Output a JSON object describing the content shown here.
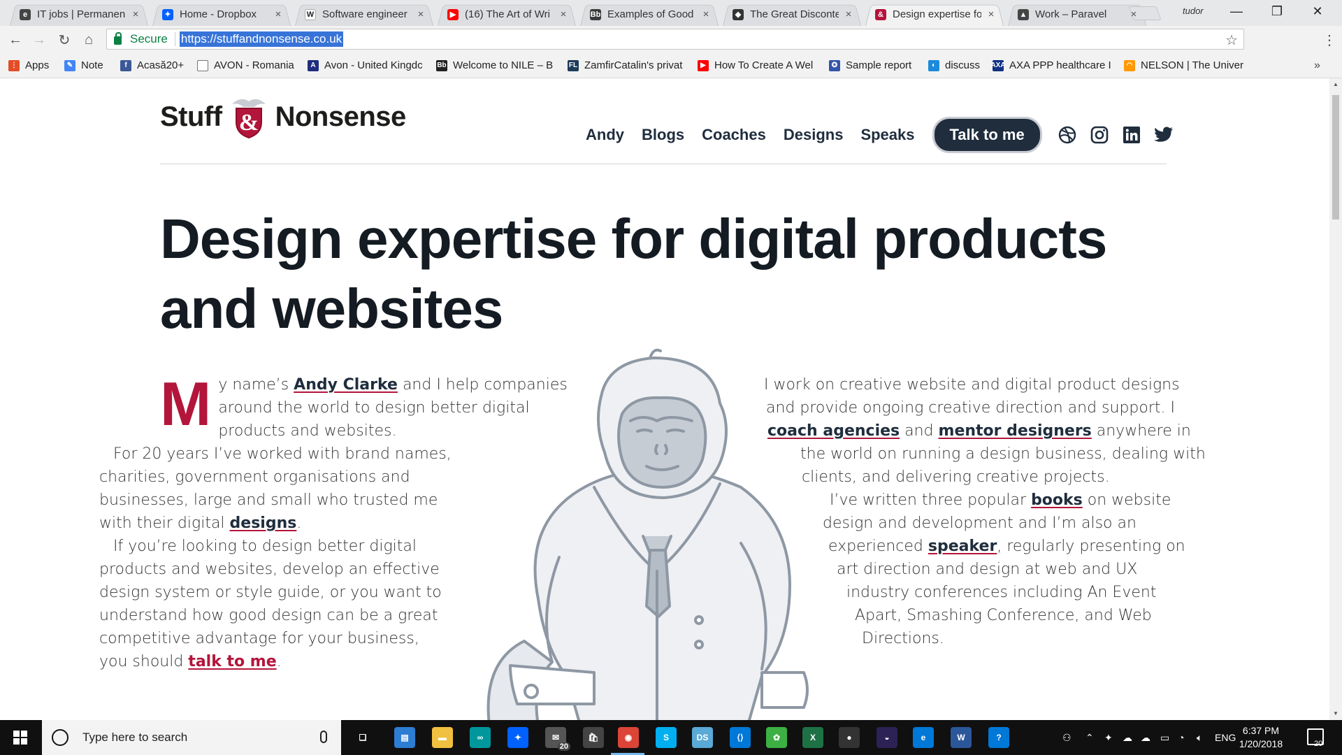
{
  "browser": {
    "tabs": [
      {
        "title": "IT jobs | Permanen",
        "favicon": "it-jobs",
        "color": "#444444",
        "glyph": "e"
      },
      {
        "title": "Home - Dropbox",
        "favicon": "dropbox",
        "color": "#0061fe",
        "glyph": "✦"
      },
      {
        "title": "Software engineer",
        "favicon": "wikipedia",
        "color": "#ffffff",
        "glyph": "W"
      },
      {
        "title": "(16) The Art of Wri",
        "favicon": "youtube",
        "color": "#ff0000",
        "glyph": "▶"
      },
      {
        "title": "Examples of Good",
        "favicon": "bb",
        "color": "#3b3b3b",
        "glyph": "Bb"
      },
      {
        "title": "The Great Disconte",
        "favicon": "medium",
        "color": "#333333",
        "glyph": "◆"
      },
      {
        "title": "Design expertise fo",
        "favicon": "stuffandnonsense",
        "color": "#b3153b",
        "glyph": "&"
      },
      {
        "title": "Work – Paravel",
        "favicon": "paravel",
        "color": "#444444",
        "glyph": "▲"
      }
    ],
    "active_tab": 6,
    "profile": "tudor",
    "secure_label": "Secure",
    "url": "https://stuffandnonsense.co.uk",
    "bookmarks": [
      {
        "label": "Apps",
        "color": "#e44d26",
        "glyph": "⋮"
      },
      {
        "label": "Note",
        "color": "#4285f4",
        "glyph": "✎"
      },
      {
        "label": "Acasă20+",
        "color": "#3b5998",
        "glyph": "f"
      },
      {
        "label": "AVON - Romania",
        "color": "#ffffff",
        "glyph": ""
      },
      {
        "label": "Avon - United Kingdc",
        "color": "#1f2d7d",
        "glyph": "A"
      },
      {
        "label": "Welcome to NILE – B",
        "color": "#222222",
        "glyph": "Bb"
      },
      {
        "label": "ZamfirCatalin's privat",
        "color": "#1e3c5a",
        "glyph": "FL"
      },
      {
        "label": "How To Create A Wel",
        "color": "#ff0000",
        "glyph": "▶"
      },
      {
        "label": "Sample report",
        "color": "#3355aa",
        "glyph": "✪"
      },
      {
        "label": "discuss",
        "color": "#1c8adb",
        "glyph": "◐"
      },
      {
        "label": "AXA PPP healthcare I",
        "color": "#103184",
        "glyph": "AXA"
      },
      {
        "label": "NELSON | The Univer",
        "color": "#ff9900",
        "glyph": "◠"
      }
    ]
  },
  "site": {
    "logo_left": "Stuff",
    "logo_right": "Nonsense",
    "nav": [
      "Andy",
      "Blogs",
      "Coaches",
      "Designs",
      "Speaks"
    ],
    "cta": "Talk to me",
    "social": [
      "dribbble-icon",
      "instagram-icon",
      "linkedin-icon",
      "twitter-icon"
    ],
    "headline_line1": "Design expertise for digital products",
    "headline_line2": "and websites",
    "left": {
      "dropcap": "M",
      "l1a": "y name’s ",
      "l1link": "Andy Clarke",
      "l1b": " and I help companies",
      "l2": "around the world to design better digital",
      "l3": "products and websites.",
      "l4": "For 20 years I’ve worked with brand names,",
      "l5": "charities, government organisations and",
      "l6": "businesses, large and small who trusted me",
      "l7a": "with their digital ",
      "l7link": "designs",
      "l7b": ".",
      "l8": "If you’re looking to design better digital",
      "l9": "products and websites, develop an effective",
      "l10": "design system or style guide, or you want to",
      "l11": "understand how good design can be a great",
      "l12": "competitive advantage for your business,",
      "l13a": "you should ",
      "l13link": "talk to me",
      "l13b": "."
    },
    "right": {
      "l1": "I work on creative website and digital product designs",
      "l2": "and provide ongoing creative direction and support. I",
      "l3link1": "coach agencies",
      "l3mid": " and ",
      "l3link2": "mentor designers",
      "l3b": " anywhere in",
      "l4": "the world on running a design business, dealing with",
      "l5": "clients, and delivering creative projects.",
      "l6a": "I’ve written three popular ",
      "l6link": "books",
      "l6b": " on website",
      "l7": "design and development and I’m also an",
      "l8a": "experienced ",
      "l8link": "speaker",
      "l8b": ", regularly presenting on",
      "l9": "art direction and design at web and UX",
      "l10": "industry conferences including An Event",
      "l11": "Apart, Smashing Conference, and Web",
      "l12": "Directions."
    }
  },
  "taskbar": {
    "search_placeholder": "Type here to search",
    "mail_badge": "20",
    "language": "ENG",
    "time": "6:37 PM",
    "date": "1/20/2018",
    "notifications": "20"
  }
}
